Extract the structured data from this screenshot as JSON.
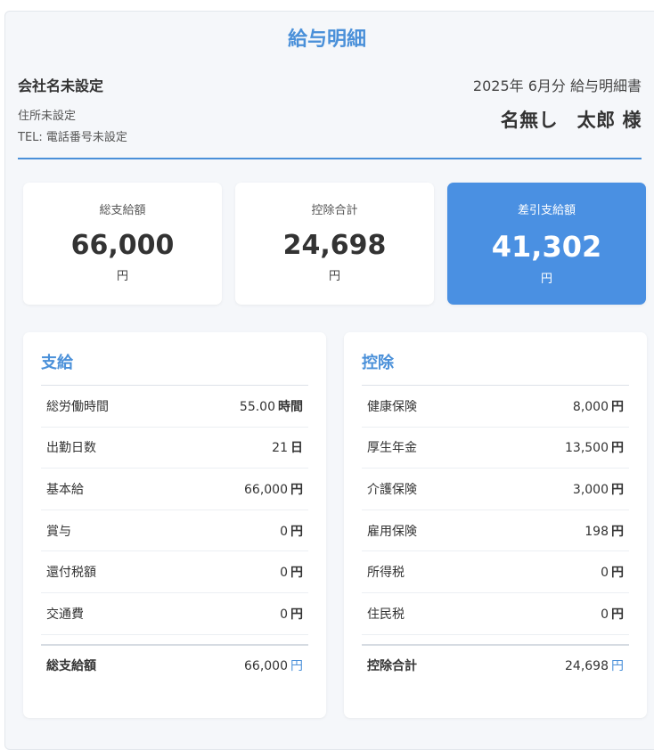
{
  "title": "給与明細",
  "company": {
    "name": "会社名未設定",
    "address": "住所未設定",
    "tel": "TEL: 電話番号未設定"
  },
  "period": "2025年 6月分 給与明細書",
  "employee": "名無し　太郎 様",
  "summary": [
    {
      "label": "総支給額",
      "value": "66,000",
      "unit": "円"
    },
    {
      "label": "控除合計",
      "value": "24,698",
      "unit": "円"
    },
    {
      "label": "差引支給額",
      "value": "41,302",
      "unit": "円"
    }
  ],
  "earnings": {
    "heading": "支給",
    "rows": [
      {
        "label": "総労働時間",
        "value": "55.00",
        "unit": "時間"
      },
      {
        "label": "出勤日数",
        "value": "21",
        "unit": "日"
      },
      {
        "label": "基本給",
        "value": "66,000",
        "unit": "円"
      },
      {
        "label": "賞与",
        "value": "0",
        "unit": "円"
      },
      {
        "label": "還付税額",
        "value": "0",
        "unit": "円"
      },
      {
        "label": "交通費",
        "value": "0",
        "unit": "円"
      }
    ],
    "total": {
      "label": "総支給額",
      "value": "66,000",
      "unit": "円"
    }
  },
  "deductions": {
    "heading": "控除",
    "rows": [
      {
        "label": "健康保険",
        "value": "8,000",
        "unit": "円"
      },
      {
        "label": "厚生年金",
        "value": "13,500",
        "unit": "円"
      },
      {
        "label": "介護保険",
        "value": "3,000",
        "unit": "円"
      },
      {
        "label": "雇用保険",
        "value": "198",
        "unit": "円"
      },
      {
        "label": "所得税",
        "value": "0",
        "unit": "円"
      },
      {
        "label": "住民税",
        "value": "0",
        "unit": "円"
      }
    ],
    "total": {
      "label": "控除合計",
      "value": "24,698",
      "unit": "円"
    }
  },
  "colors": {
    "accent": "#4a90d9",
    "net_card": "#4a90e2"
  }
}
